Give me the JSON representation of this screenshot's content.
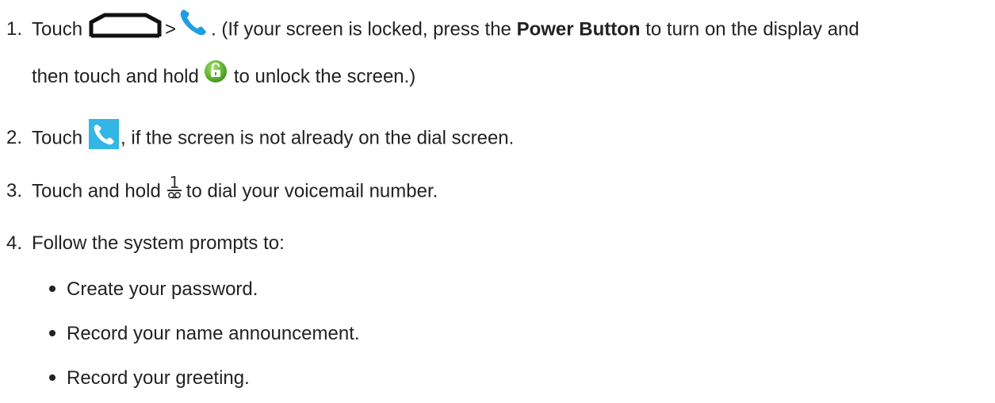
{
  "steps": [
    {
      "num": "1.",
      "touch": "Touch",
      "gt": ">",
      "text_a": ". (If your screen is locked, press the",
      "power_button": "Power Button",
      "text_b": "to turn on the display and",
      "line2_a": "then touch and hold",
      "line2_b": "to unlock the screen.)",
      "icons": [
        "home-key-icon",
        "phone-icon",
        "unlock-icon"
      ]
    },
    {
      "num": "2.",
      "touch": "Touch",
      "text": ", if the screen is not already on the dial screen.",
      "icons": [
        "phone-tile-icon"
      ]
    },
    {
      "num": "3.",
      "touch": "Touch and hold",
      "text": "to dial your voicemail number.",
      "icons": [
        "voicemail-key-icon"
      ]
    },
    {
      "num": "4.",
      "text": "Follow the system prompts to:"
    }
  ],
  "bullets": [
    "Create your password.",
    "Record your name announcement.",
    "Record your greeting."
  ],
  "icon_labels": {
    "dialkey_digit": "1"
  },
  "colors": {
    "text": "#222222",
    "phone_blue": "#1e9fe3",
    "tile_blue": "#33b5e5",
    "lock_green": "#6cc233"
  }
}
